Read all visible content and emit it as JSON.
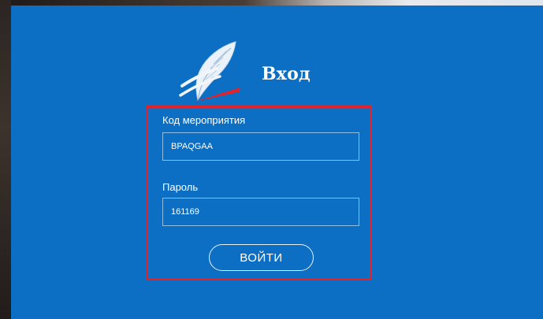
{
  "header": {
    "title": "Вход",
    "logo_icon": "feather-quill-icon"
  },
  "form": {
    "event_code": {
      "label": "Код мероприятия",
      "value": "BPAQGAA"
    },
    "password": {
      "label": "Пароль",
      "value": "161169"
    },
    "submit_label": "ВОЙТИ"
  },
  "colors": {
    "panel_bg": "#0d6fc3",
    "highlight_border": "#e3232b",
    "text": "#ffffff",
    "accent_red": "#e3232b"
  }
}
